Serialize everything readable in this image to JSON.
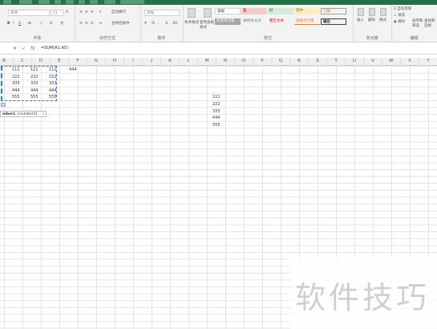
{
  "ribbon": {
    "groups": {
      "font": "字体",
      "alignment": "对齐方式",
      "number": "数字",
      "styles": "样式",
      "cells": "单元格",
      "editing": "编辑"
    },
    "font_name": "宋体",
    "font_size": "11",
    "wrap_text": "自动换行",
    "merge_center": "合并后居中",
    "number_format": "常规",
    "cond_format": "条件格式",
    "format_table": "套用表格格式",
    "cell_styles": {
      "normal": "常规",
      "bad": "差",
      "good": "好",
      "neutral": "适中",
      "calc": "计算",
      "check": "检查单元格",
      "explain": "解释性文本",
      "warn": "警告文本",
      "link": "链接单元格",
      "output": "输出"
    },
    "insert": "插入",
    "delete": "删除",
    "format": "格式",
    "autosum": "自动求和",
    "fill": "填充",
    "clear": "清除",
    "sort_filter": "排序和筛选",
    "find_select": "查找和选择"
  },
  "formula_bar": {
    "cancel": "✕",
    "confirm": "✓",
    "fx": "fx",
    "formula": "=SUM(A1:A5)"
  },
  "columns": [
    "B",
    "C",
    "D",
    "E",
    "F",
    "G",
    "H",
    "I",
    "J",
    "K",
    "L",
    "M",
    "N",
    "O",
    "P",
    "Q",
    "R",
    "S",
    "T",
    "U",
    "V",
    "W",
    "X",
    "Y"
  ],
  "cells": {
    "b": [
      "111",
      "222",
      "333",
      "444",
      "555"
    ],
    "c": [
      "111",
      "222",
      "333",
      "444",
      "555"
    ],
    "d": [
      "111",
      "222",
      "333",
      "444",
      "555"
    ],
    "e1": "444",
    "m": [
      "111",
      "222",
      "333",
      "444",
      "555"
    ]
  },
  "tooltip": {
    "func": "mber1",
    "args": ", [number2], ...)"
  },
  "watermark": "软件技巧"
}
